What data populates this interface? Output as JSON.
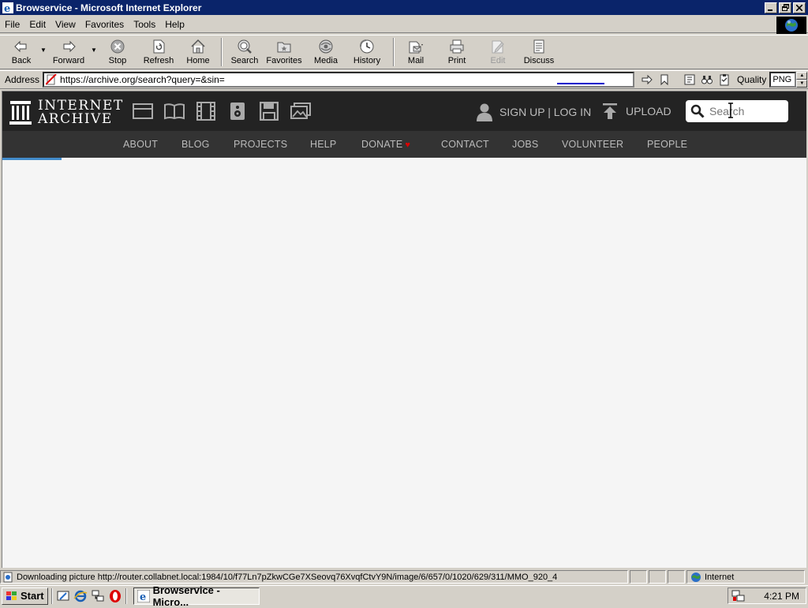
{
  "window": {
    "title": "Browservice - Microsoft Internet Explorer"
  },
  "menu": [
    "File",
    "Edit",
    "View",
    "Favorites",
    "Tools",
    "Help"
  ],
  "toolbar": {
    "back": "Back",
    "forward": "Forward",
    "stop": "Stop",
    "refresh": "Refresh",
    "home": "Home",
    "search": "Search",
    "favorites": "Favorites",
    "media": "Media",
    "history": "History",
    "mail": "Mail",
    "print": "Print",
    "edit": "Edit",
    "discuss": "Discuss"
  },
  "address": {
    "label": "Address",
    "url": "https://archive.org/search?query=&sin=",
    "quality_label": "Quality",
    "quality_value": "PNG"
  },
  "site": {
    "logo_line1": "INTERNET",
    "logo_line2": "ARCHIVE",
    "media_icons": [
      "web-icon",
      "texts-icon",
      "video-icon",
      "audio-icon",
      "software-icon",
      "images-icon"
    ],
    "signup_login": "SIGN UP | LOG IN",
    "upload": "UPLOAD",
    "search_placeholder": "Search",
    "nav": {
      "about": "ABOUT",
      "blog": "BLOG",
      "projects": "PROJECTS",
      "help": "HELP",
      "donate": "DONATE",
      "contact": "CONTACT",
      "jobs": "JOBS",
      "volunteer": "VOLUNTEER",
      "people": "PEOPLE"
    },
    "colors": {
      "header_bg": "#232323",
      "nav_bg": "#333333",
      "progress": "#428bca",
      "heart": "#dd0000"
    }
  },
  "status": {
    "text": "Downloading picture http://router.collabnet.local:1984/10/f77Ln7pZkwCGe7XSeovq76XvqfCtvY9N/image/6/657/0/1020/629/311/MMO_920_4",
    "zone": "Internet"
  },
  "taskbar": {
    "start": "Start",
    "task": "Browservice - Micro...",
    "clock": "4:21 PM"
  }
}
